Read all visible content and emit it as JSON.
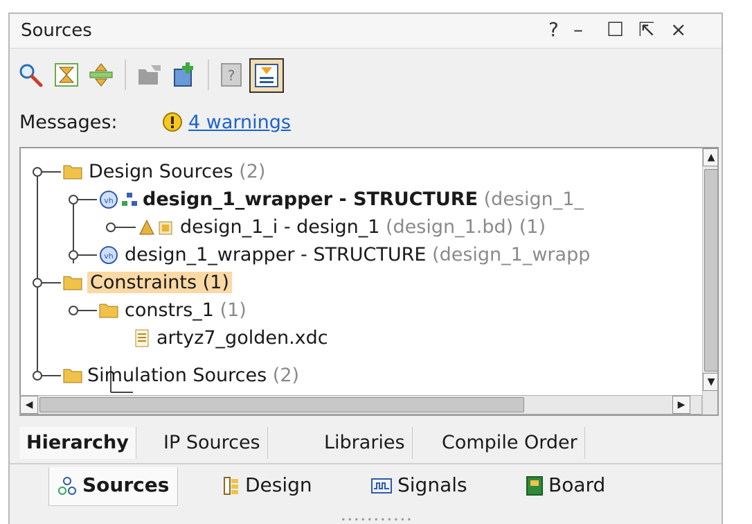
{
  "window": {
    "title": "Sources",
    "controls": {
      "help": "?",
      "minimize": "–",
      "maximize": "☐",
      "float": "⇱",
      "close": "×"
    }
  },
  "toolbar": {
    "icons": [
      "search-icon",
      "collapse-all-icon",
      "expand-all-icon",
      "open-folder-icon",
      "add-sources-icon",
      "properties-icon",
      "auto-update-icon"
    ]
  },
  "messages": {
    "label": "Messages:",
    "warnings_link": "4 warnings"
  },
  "tree": {
    "rows": [
      {
        "id": "design-sources",
        "label": "Design Sources",
        "count": "(2)"
      },
      {
        "id": "design-1-wrapper-top",
        "label": "design_1_wrapper - STRUCTURE",
        "detail": "(design_1_"
      },
      {
        "id": "design-1-i",
        "label": "design_1_i - design_1",
        "detail": "(design_1.bd) (1)"
      },
      {
        "id": "design-1-wrapper",
        "label": "design_1_wrapper - STRUCTURE",
        "detail": "(design_1_wrapp"
      },
      {
        "id": "constraints",
        "label": "Constraints (1)"
      },
      {
        "id": "constrs-1",
        "label": "constrs_1",
        "count": "(1)"
      },
      {
        "id": "artyz7-xdc",
        "label": "artyz7_golden.xdc"
      },
      {
        "id": "simulation-sources",
        "label": "Simulation Sources",
        "count": "(2)"
      }
    ]
  },
  "view_tabs": [
    "Hierarchy",
    "IP Sources",
    "Libraries",
    "Compile Order"
  ],
  "bottom_tabs": [
    "Sources",
    "Design",
    "Signals",
    "Board"
  ],
  "colors": {
    "link": "#1b63c9",
    "highlight": "#fbd9a4",
    "muted_text": "#8a8a8a",
    "folder": "#f0c24a"
  }
}
